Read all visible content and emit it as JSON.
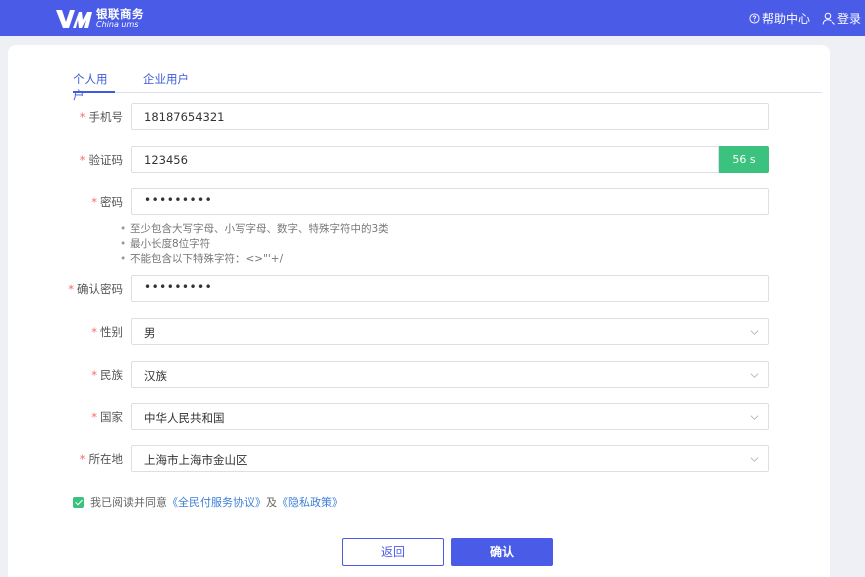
{
  "header": {
    "brand_cn": "银联商务",
    "brand_en": "China ums",
    "help_label": "帮助中心",
    "login_label": "登录"
  },
  "tabs": [
    {
      "label": "个人用户",
      "active": true
    },
    {
      "label": "企业用户",
      "active": false
    }
  ],
  "form": {
    "phone": {
      "label": "手机号",
      "value": "18187654321"
    },
    "code": {
      "label": "验证码",
      "value": "123456",
      "countdown": "56 s"
    },
    "password": {
      "label": "密码",
      "value": "•••••••••"
    },
    "password_hints": [
      "至少包含大写字母、小写字母、数字、特殊字符中的3类",
      "最小长度8位字符",
      "不能包含以下特殊字符：<>\"'+/"
    ],
    "confirm_password": {
      "label": "确认密码",
      "value": "•••••••••"
    },
    "gender": {
      "label": "性别",
      "value": "男"
    },
    "ethnicity": {
      "label": "民族",
      "value": "汉族"
    },
    "country": {
      "label": "国家",
      "value": "中华人民共和国"
    },
    "location": {
      "label": "所在地",
      "value": "上海市上海市金山区"
    }
  },
  "agreement": {
    "checked": true,
    "prefix": "我已阅读并同意",
    "link1": "《全民付服务协议》",
    "and": "及",
    "link2": "《隐私政策》"
  },
  "buttons": {
    "back": "返回",
    "confirm": "确认"
  },
  "colors": {
    "header_bg": "#4a5be8",
    "accent": "#3d5bdb",
    "countdown_bg": "#3cc27f",
    "required_star": "#f56c6c"
  }
}
